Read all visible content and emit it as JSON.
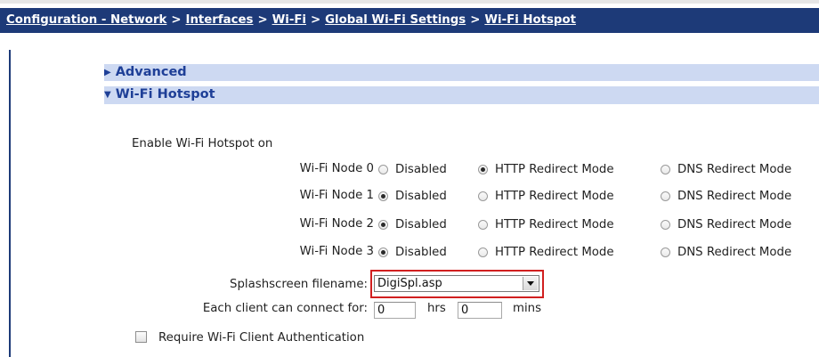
{
  "breadcrumb": {
    "items": [
      "Configuration - Network",
      "Interfaces",
      "Wi-Fi",
      "Global Wi-Fi Settings",
      "Wi-Fi Hotspot"
    ],
    "separator": ">"
  },
  "sections": {
    "advanced": {
      "label": "Advanced",
      "expanded": false,
      "arrow": "▶"
    },
    "hotspot": {
      "label": "Wi-Fi Hotspot",
      "expanded": true,
      "arrow": "▼"
    }
  },
  "form": {
    "enable_label": "Enable Wi-Fi Hotspot on",
    "option_labels": [
      "Disabled",
      "HTTP Redirect Mode",
      "DNS Redirect Mode"
    ],
    "nodes": [
      {
        "label": "Wi-Fi Node 0",
        "selected": "HTTP Redirect Mode"
      },
      {
        "label": "Wi-Fi Node 1",
        "selected": "Disabled"
      },
      {
        "label": "Wi-Fi Node 2",
        "selected": "Disabled"
      },
      {
        "label": "Wi-Fi Node 3",
        "selected": "Disabled"
      }
    ],
    "splash_label": "Splashscreen filename:",
    "splash_value": "DigiSpl.asp",
    "connect_label": "Each client can connect for:",
    "hours_value": "0",
    "hours_unit": "hrs",
    "minutes_value": "0",
    "minutes_unit": "mins",
    "auth_label": "Require Wi-Fi Client Authentication",
    "auth_checked": false
  },
  "colors": {
    "breadcrumb_bg": "#1d3a78",
    "section_bg": "#cdd9f2",
    "section_text": "#1e3f97",
    "highlight": "#d11f1f"
  }
}
